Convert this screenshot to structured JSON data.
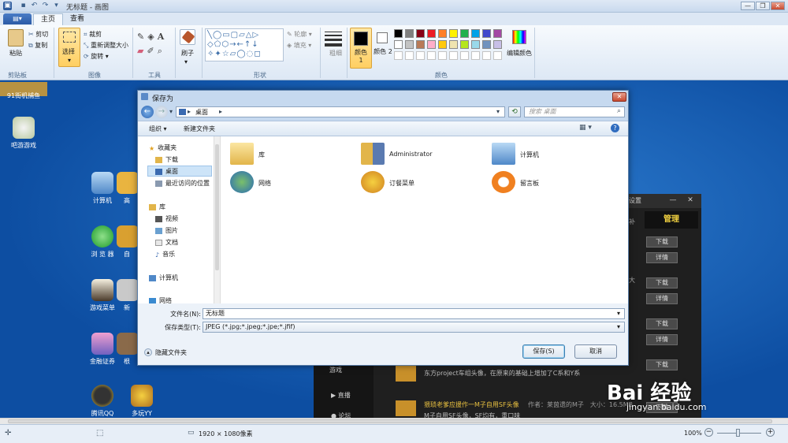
{
  "window": {
    "title": "无标题 - 画图",
    "controls": [
      "—",
      "❐",
      "✕"
    ]
  },
  "tabs": {
    "menu": "▤▾",
    "home": "主页",
    "view": "查看"
  },
  "ribbon": {
    "clipboard": {
      "paste": "粘贴",
      "cut": "剪切",
      "copy": "复制",
      "label": "剪贴板"
    },
    "image": {
      "select": "选择",
      "crop": "裁剪",
      "resize": "重新调整大小",
      "rotate": "旋转",
      "label": "图像"
    },
    "tools": {
      "label": "工具"
    },
    "brushes": {
      "label": "刷子"
    },
    "shapes": {
      "outline": "轮廓",
      "fill": "填充",
      "label": "形状"
    },
    "size": {
      "label": "粗细"
    },
    "colors": {
      "color1": "颜色 1",
      "color2": "颜色 2",
      "edit": "编辑颜色",
      "label": "颜色",
      "palette": [
        "#000000",
        "#7f7f7f",
        "#880015",
        "#ed1c24",
        "#ff7f27",
        "#fff200",
        "#22b14c",
        "#00a2e8",
        "#3f48cc",
        "#a349a4",
        "#ffffff",
        "#c3c3c3",
        "#b97a57",
        "#ffaec9",
        "#ffc90e",
        "#efe4b0",
        "#b5e61d",
        "#99d9ea",
        "#7092be",
        "#c8bfe7"
      ]
    }
  },
  "desktop": {
    "icons": [
      "91街机捕鱼",
      "吧游游戏",
      "计算机",
      "浏 览 器",
      "游戏菜单",
      "金融证券",
      "腾讯QQ",
      "多玩YY"
    ],
    "partial_icons": [
      "高",
      "自",
      "新",
      "根"
    ]
  },
  "bg_app": {
    "settings": "设置",
    "manage": "管理",
    "download": "下载",
    "details": "详情",
    "menu1": "游戏",
    "menu2": "直播",
    "menu3": "论坛",
    "item1": "东方project车组头像，在原来的基础上增加了C系和Y系",
    "item2_title": "猥琐老爹应援作一M子自用SF头像",
    "item2_meta": "作者：莱茵遗的M子　大小：16.5MB",
    "item2_sub": "M子自用SF头像，SF均有，重口味",
    "letter1": "补",
    "letter2": "大"
  },
  "dialog": {
    "title": "保存为",
    "address": "桌面",
    "search_placeholder": "搜索 桌面",
    "organize": "组织 ▾",
    "new_folder": "新建文件夹",
    "nav": [
      "收藏夹",
      "下载",
      "桌面",
      "最近访问的位置",
      "库",
      "视频",
      "图片",
      "文档",
      "音乐",
      "计算机",
      "网络"
    ],
    "items": [
      "库",
      "Administrator",
      "计算机",
      "网络",
      "订餐菜单",
      "留言板"
    ],
    "filename_label": "文件名(N):",
    "filename_value": "无标题",
    "filetype_label": "保存类型(T):",
    "filetype_value": "JPEG (*.jpg;*.jpeg;*.jpe;*.jfif)",
    "hide_folders": "隐藏文件夹",
    "save": "保存(S)",
    "cancel": "取消"
  },
  "status": {
    "dimensions": "1920 × 1080像素",
    "zoom": "100%"
  },
  "watermark": {
    "brand": "Bai 经验",
    "url": "jingyan.baidu.com"
  }
}
